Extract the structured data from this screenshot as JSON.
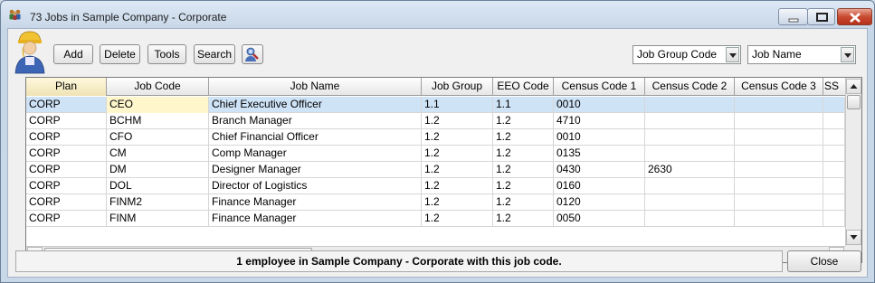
{
  "window": {
    "title": "73 Jobs in Sample Company - Corporate"
  },
  "toolbar": {
    "add_label": "Add",
    "delete_label": "Delete",
    "tools_label": "Tools",
    "search_label": "Search",
    "find_icon": "find-person-icon",
    "sort_primary": "Job Group Code",
    "sort_secondary": "Job Name"
  },
  "grid": {
    "columns": [
      "Plan",
      "Job Code",
      "Job Name",
      "Job Group",
      "EEO Code",
      "Census Code 1",
      "Census Code 2",
      "Census Code 3",
      "SS"
    ],
    "rows": [
      [
        "CORP",
        "CEO",
        "Chief Executive Officer",
        "1.1",
        "1.1",
        "0010",
        "",
        "",
        ""
      ],
      [
        "CORP",
        "BCHM",
        "Branch Manager",
        "1.2",
        "1.2",
        "4710",
        "",
        "",
        ""
      ],
      [
        "CORP",
        "CFO",
        "Chief Financial Officer",
        "1.2",
        "1.2",
        "0010",
        "",
        "",
        ""
      ],
      [
        "CORP",
        "CM",
        "Comp Manager",
        "1.2",
        "1.2",
        "0135",
        "",
        "",
        ""
      ],
      [
        "CORP",
        "DM",
        "Designer Manager",
        "1.2",
        "1.2",
        "0430",
        "2630",
        "",
        ""
      ],
      [
        "CORP",
        "DOL",
        "Director of Logistics",
        "1.2",
        "1.2",
        "0160",
        "",
        "",
        ""
      ],
      [
        "CORP",
        "FINM2",
        "Finance Manager",
        "1.2",
        "1.2",
        "0120",
        "",
        "",
        ""
      ],
      [
        "CORP",
        "FINM",
        "Finance Manager",
        "1.2",
        "1.2",
        "0050",
        "",
        "",
        ""
      ]
    ],
    "selected_row": 0
  },
  "status": {
    "message": "1 employee in Sample Company - Corporate with this job code."
  },
  "footer": {
    "close_label": "Close"
  },
  "colors": {
    "selection": "#cfe3f7",
    "focus_cell": "#fff6cc",
    "title_bar": "#c8d7e8"
  }
}
